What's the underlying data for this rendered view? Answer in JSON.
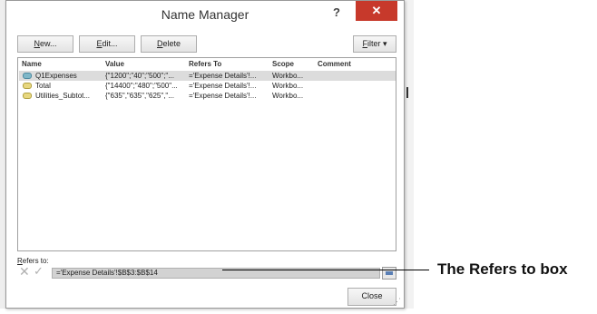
{
  "window": {
    "title": "Name Manager",
    "help": "?",
    "close": "✕"
  },
  "toolbar": {
    "new": {
      "u": "N",
      "rest": "ew..."
    },
    "edit": {
      "u": "E",
      "rest": "dit..."
    },
    "delete": {
      "u": "D",
      "rest": "elete"
    },
    "filter": {
      "u": "F",
      "rest": "ilter ▾"
    }
  },
  "columns": [
    "Name",
    "Value",
    "Refers To",
    "Scope",
    "Comment"
  ],
  "rows": [
    {
      "name": "Q1Expenses",
      "value": "{\"1200\";\"40\";\"500\";\"...",
      "refers_to": "='Expense Details'!...",
      "scope": "Workbo...",
      "comment": "",
      "selected": true
    },
    {
      "name": "Total",
      "value": "{\"14400\";\"480\";\"500\"...",
      "refers_to": "='Expense Details'!...",
      "scope": "Workbo...",
      "comment": "",
      "selected": false
    },
    {
      "name": "Utilities_Subtot...",
      "value": "{\"635\",\"635\",\"625\",\"...",
      "refers_to": "='Expense Details'!...",
      "scope": "Workbo...",
      "comment": "",
      "selected": false
    }
  ],
  "refers": {
    "label_u": "R",
    "label_rest": "efers to:",
    "value": "='Expense Details'!$B$3:$B$14",
    "cancel": "✕",
    "confirm": "✓"
  },
  "close_button": "Close",
  "callout": "The Refers to box"
}
